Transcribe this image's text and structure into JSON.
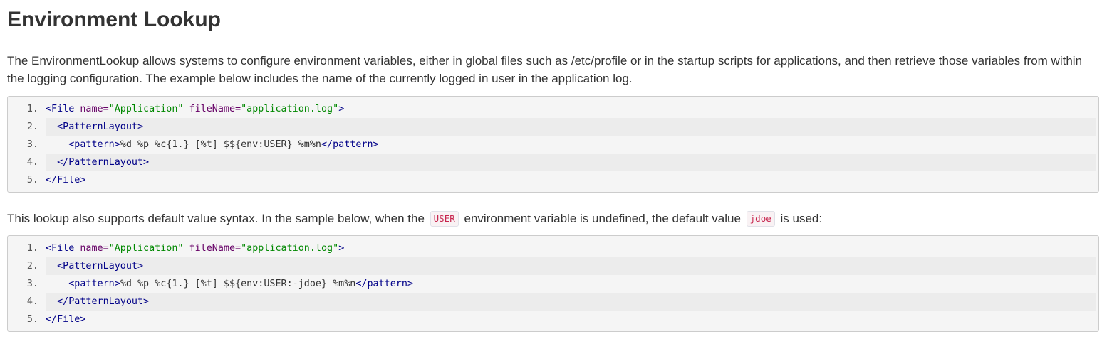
{
  "heading": "Environment Lookup",
  "intro": "The EnvironmentLookup allows systems to configure environment variables, either in global files such as /etc/profile or in the startup scripts for applications, and then retrieve those variables from within the logging configuration. The example below includes the name of the currently logged in user in the application log.",
  "default_para": {
    "before": "This lookup also supports default value syntax. In the sample below, when the",
    "code1": "USER",
    "middle": "environment variable is undefined, the default value",
    "code2": "jdoe",
    "after": "is used:"
  },
  "code_block_1": {
    "line_numbers": [
      "1.",
      "2.",
      "3.",
      "4.",
      "5."
    ],
    "l1": {
      "open": "<File",
      "attr1_name": " name=",
      "attr1_value": "\"Application\"",
      "attr2_name": " fileName=",
      "attr2_value": "\"application.log\"",
      "close": ">"
    },
    "l2": {
      "indent": "  ",
      "tag": "<PatternLayout>"
    },
    "l3": {
      "indent": "    ",
      "open": "<pattern>",
      "text": "%d %p %c{1.} [%t] $${env:USER} %m%n",
      "close": "</pattern>"
    },
    "l4": {
      "indent": "  ",
      "tag": "</PatternLayout>"
    },
    "l5": {
      "tag": "</File>"
    }
  },
  "code_block_2": {
    "line_numbers": [
      "1.",
      "2.",
      "3.",
      "4.",
      "5."
    ],
    "l1": {
      "open": "<File",
      "attr1_name": " name=",
      "attr1_value": "\"Application\"",
      "attr2_name": " fileName=",
      "attr2_value": "\"application.log\"",
      "close": ">"
    },
    "l2": {
      "indent": "  ",
      "tag": "<PatternLayout>"
    },
    "l3": {
      "indent": "    ",
      "open": "<pattern>",
      "text": "%d %p %c{1.} [%t] $${env:USER:-jdoe} %m%n",
      "close": "</pattern>"
    },
    "l4": {
      "indent": "  ",
      "tag": "</PatternLayout>"
    },
    "l5": {
      "tag": "</File>"
    }
  }
}
